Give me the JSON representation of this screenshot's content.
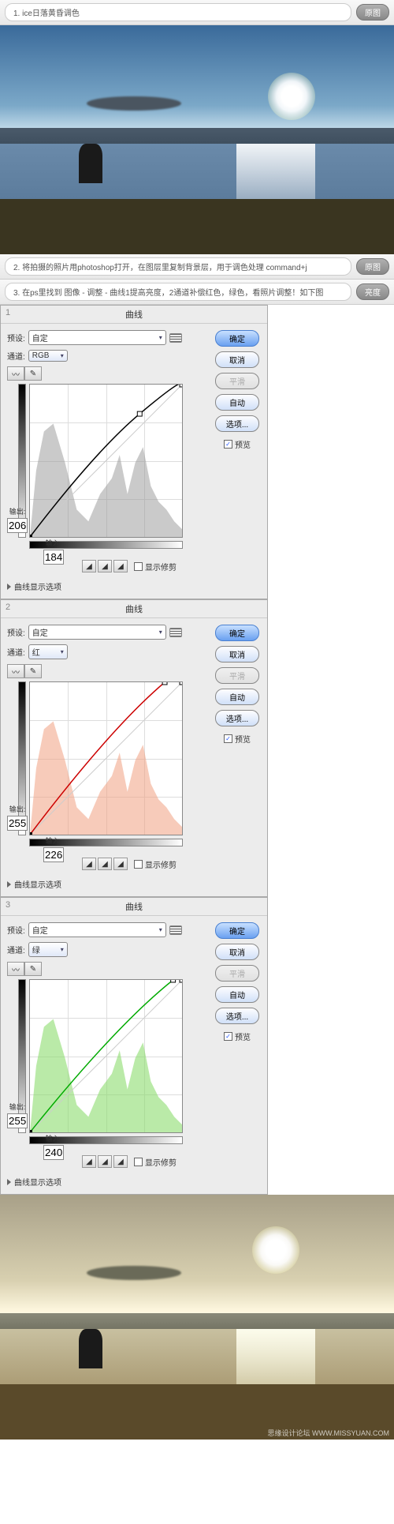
{
  "step1": {
    "text": "1. ice日落黄昏调色",
    "btn": "原图"
  },
  "step2": {
    "text": "2. 将拍摄的照片用photoshop打开，在图层里复制背景层，用于调色处理 command+j",
    "btn": "原图"
  },
  "step3": {
    "text": "3. 在ps里找到 图像 - 调整 - 曲线1提高亮度，2通道补偿红色，绿色，看照片调整！如下图",
    "btn": "亮度"
  },
  "dialog": {
    "title": "曲线",
    "preset_label": "预设:",
    "preset_value": "自定",
    "channel_label": "通道:",
    "output_label": "输出:",
    "input_label": "输入:",
    "show_clip": "显示修剪",
    "options_label": "曲线显示选项",
    "btn_ok": "确定",
    "btn_cancel": "取消",
    "btn_smooth": "平滑",
    "btn_auto": "自动",
    "btn_options": "选项...",
    "preview": "预览"
  },
  "panels": [
    {
      "num": "1",
      "channel": "RGB",
      "output": "206",
      "input": "184",
      "color": "#bbb"
    },
    {
      "num": "2",
      "channel": "红",
      "output": "255",
      "input": "226",
      "color": "#e8a890"
    },
    {
      "num": "3",
      "channel": "绿",
      "output": "255",
      "input": "240",
      "color": "#90d870"
    }
  ],
  "watermark": "思缘设计论坛 WWW.MISSYUAN.COM",
  "chart_data": [
    {
      "type": "line",
      "title": "曲线 RGB",
      "xlabel": "输入",
      "ylabel": "输出",
      "xlim": [
        0,
        255
      ],
      "ylim": [
        0,
        255
      ],
      "series": [
        {
          "name": "RGB",
          "values": [
            [
              0,
              0
            ],
            [
              184,
              206
            ],
            [
              255,
              255
            ]
          ]
        }
      ]
    },
    {
      "type": "line",
      "title": "曲线 红",
      "xlabel": "输入",
      "ylabel": "输出",
      "xlim": [
        0,
        255
      ],
      "ylim": [
        0,
        255
      ],
      "series": [
        {
          "name": "红",
          "values": [
            [
              0,
              0
            ],
            [
              226,
              255
            ],
            [
              255,
              255
            ]
          ]
        }
      ]
    },
    {
      "type": "line",
      "title": "曲线 绿",
      "xlabel": "输入",
      "ylabel": "输出",
      "xlim": [
        0,
        255
      ],
      "ylim": [
        0,
        255
      ],
      "series": [
        {
          "name": "绿",
          "values": [
            [
              0,
              0
            ],
            [
              240,
              255
            ],
            [
              255,
              255
            ]
          ]
        }
      ]
    }
  ]
}
